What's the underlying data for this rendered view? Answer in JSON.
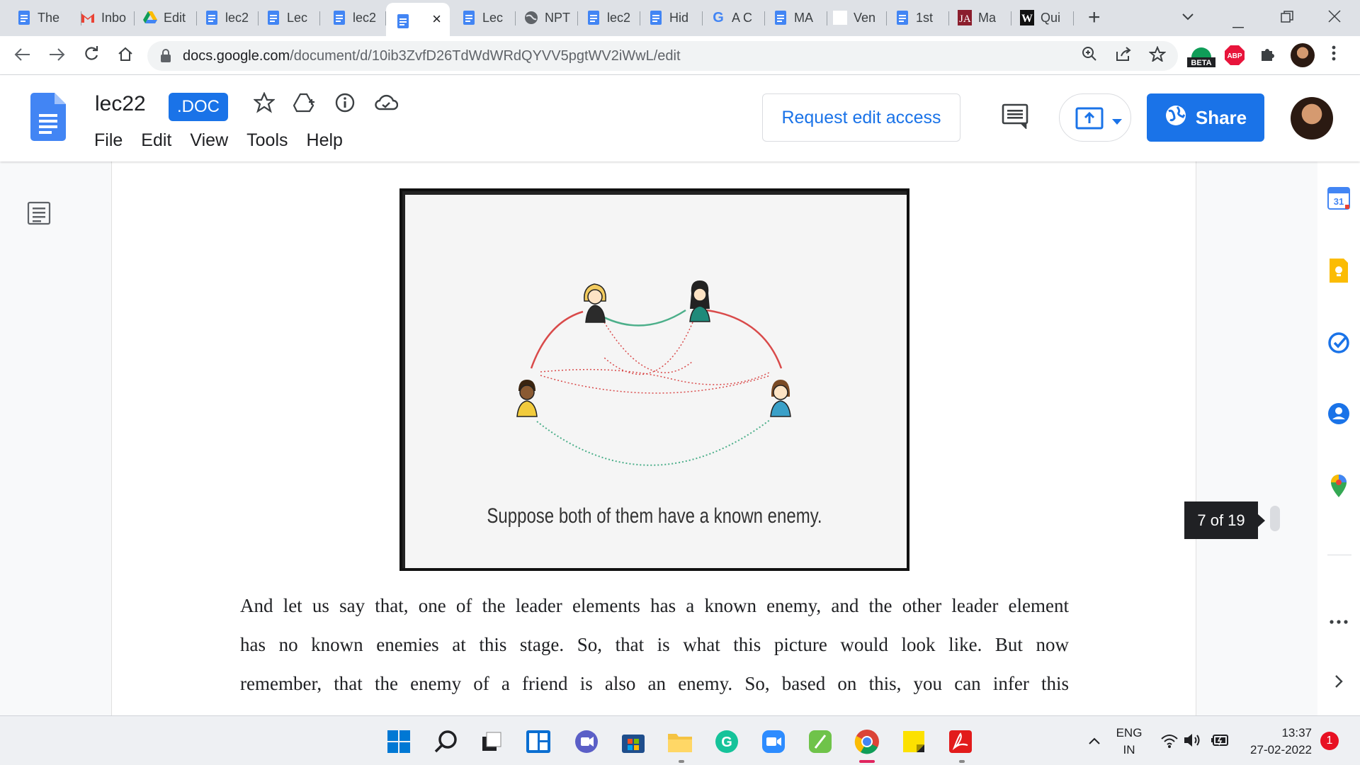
{
  "browser": {
    "tabs": [
      {
        "title": "The",
        "icon": "docs"
      },
      {
        "title": "Inbo",
        "icon": "gmail"
      },
      {
        "title": "Edit",
        "icon": "drive"
      },
      {
        "title": "lec2",
        "icon": "docs"
      },
      {
        "title": "Lec",
        "icon": "docs"
      },
      {
        "title": "lec2",
        "icon": "docs"
      },
      {
        "title": "",
        "icon": "docs",
        "active": true
      },
      {
        "title": "Lec",
        "icon": "docs"
      },
      {
        "title": "NPT",
        "icon": "globe"
      },
      {
        "title": "lec2",
        "icon": "docs"
      },
      {
        "title": "Hid",
        "icon": "docs"
      },
      {
        "title": "A C",
        "icon": "google"
      },
      {
        "title": "MA",
        "icon": "docs"
      },
      {
        "title": "Ven",
        "icon": "blank"
      },
      {
        "title": "1st",
        "icon": "docs"
      },
      {
        "title": "Ma",
        "icon": "ja"
      },
      {
        "title": "Qui",
        "icon": "w"
      }
    ],
    "close_tab_glyph": "×",
    "new_tab_glyph": "+",
    "url_host": "docs.google.com",
    "url_path": "/document/d/10ib3ZvfD26TdWdWRdQYVV5pgtWV2iWwL/edit",
    "ext_beta_label": "BETA",
    "ext_abp_label": "ABP"
  },
  "docs": {
    "title": "lec22",
    "badge": ".DOC",
    "menu": [
      "File",
      "Edit",
      "View",
      "Tools",
      "Help"
    ],
    "request_edit_label": "Request edit access",
    "share_label": "Share",
    "figure_caption": "Suppose both of them have a known enemy.",
    "paragraph_lines": [
      "And let us say that, one of the leader elements has a known enemy, and the other leader element",
      "has no known enemies at this stage. So, that is what this picture would look like. But now",
      "remember, that the enemy of a friend is also an enemy. So, based on this, you can infer this"
    ],
    "page_indicator": "7 of 19",
    "calendar_day": "31"
  },
  "taskbar": {
    "lang_top": "ENG",
    "lang_bottom": "IN",
    "time": "13:37",
    "date": "27-02-2022",
    "notification_count": "1"
  },
  "colors": {
    "accent": "#1a73e8",
    "friend_edge": "#4caf8a",
    "enemy_edge": "#d94a4a"
  }
}
